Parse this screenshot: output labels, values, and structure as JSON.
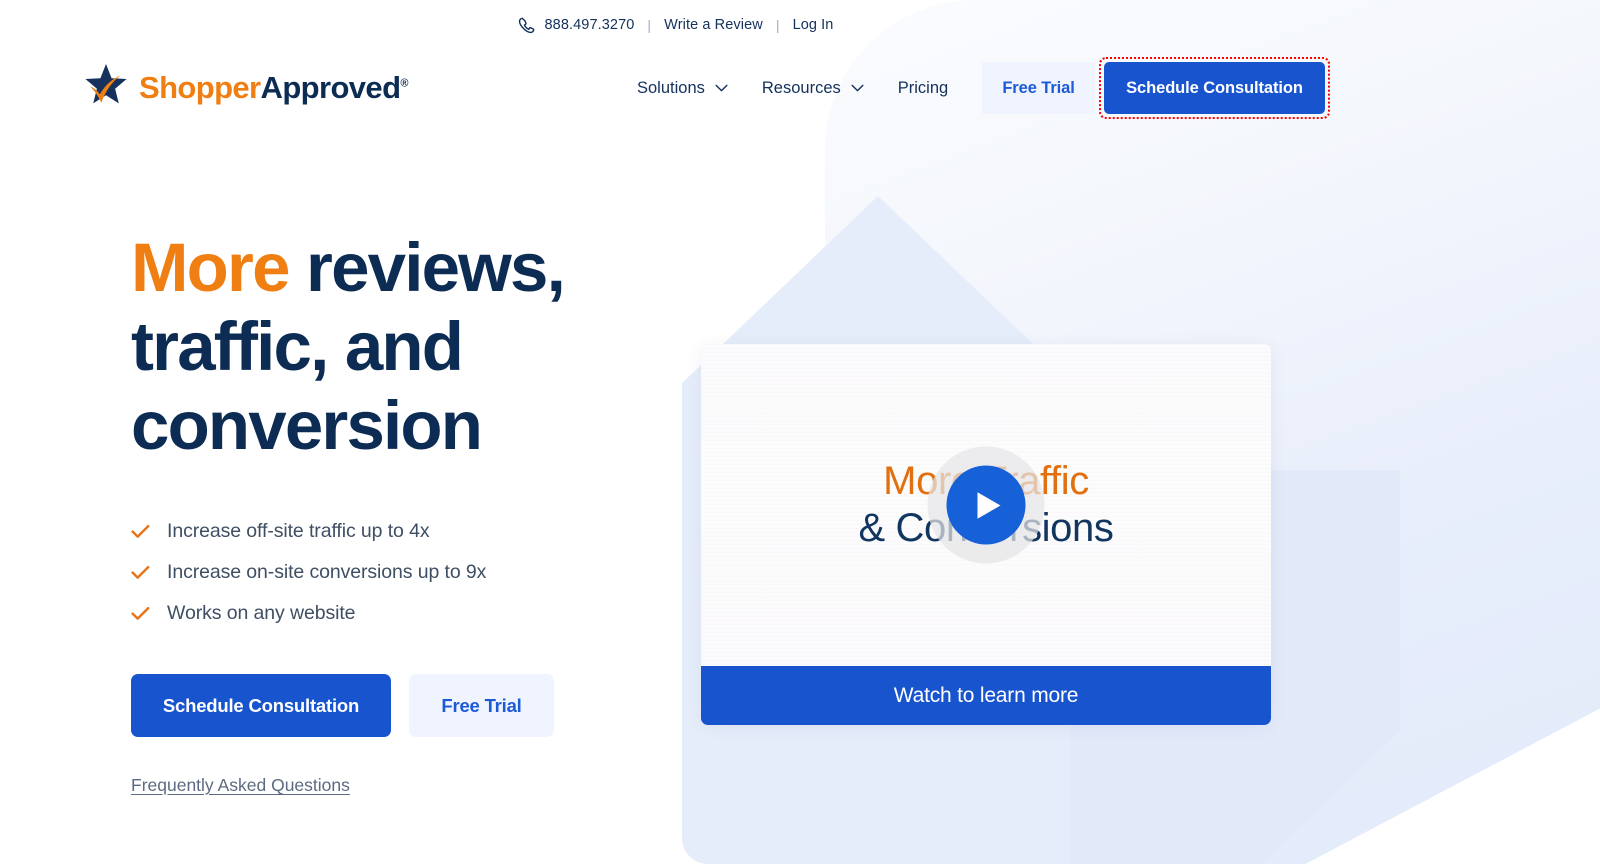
{
  "topbar": {
    "phone_icon": "phone-icon",
    "phone": "888.497.3270",
    "divider": "|",
    "write_review": "Write a Review",
    "login": "Log In"
  },
  "header": {
    "logo": {
      "icon": "star-check-logo-icon",
      "text_primary": "Shopper",
      "text_secondary": "Approved",
      "registered": "®"
    },
    "nav": [
      {
        "label": "Solutions",
        "icon": "chevron-down-icon",
        "has_dropdown": true
      },
      {
        "label": "Resources",
        "icon": "chevron-down-icon",
        "has_dropdown": true
      },
      {
        "label": "Pricing",
        "icon": "",
        "has_dropdown": false
      }
    ],
    "free_trial_label": "Free Trial",
    "schedule_label": "Schedule Consultation"
  },
  "hero": {
    "headline_highlight": "More",
    "headline_rest": " reviews, traffic, and conversion",
    "bullets": [
      {
        "icon": "check-icon",
        "text": "Increase off-site traffic up to 4x"
      },
      {
        "icon": "check-icon",
        "text": "Increase on-site conversions up to 9x"
      },
      {
        "icon": "check-icon",
        "text": "Works on any website"
      }
    ],
    "primary_cta": "Schedule Consultation",
    "secondary_cta": "Free Trial",
    "faq_link": "Frequently Asked Questions"
  },
  "video": {
    "thumb_line1": "More Traffic",
    "thumb_line2": "& Conversions",
    "play_icon": "play-icon",
    "watch_label": "Watch to learn more"
  },
  "colors": {
    "brand_navy": "#0d2c54",
    "brand_orange": "#f07f13",
    "brand_blue": "#1754ce",
    "light_blue_bg": "#eff4fe",
    "focus_ring_red": "#ff0000",
    "hex_blue": "#e6edfa"
  }
}
